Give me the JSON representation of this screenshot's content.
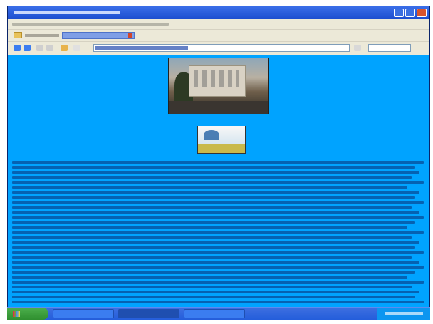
{
  "window": {
    "minimize_icon": "minimize-icon",
    "maximize_icon": "maximize-icon",
    "close_icon": "close-icon"
  },
  "links": {
    "folder_icon": "folder-icon",
    "tab_close_icon": "close-icon"
  },
  "toolbar": {
    "icons": [
      "back-icon",
      "forward-icon",
      "stop-icon",
      "refresh-icon",
      "home-icon",
      "bookmark-icon"
    ]
  },
  "colors": {
    "page_background": "#00a3ff",
    "title_bar": "#245edb",
    "text": "#0a2e73"
  }
}
